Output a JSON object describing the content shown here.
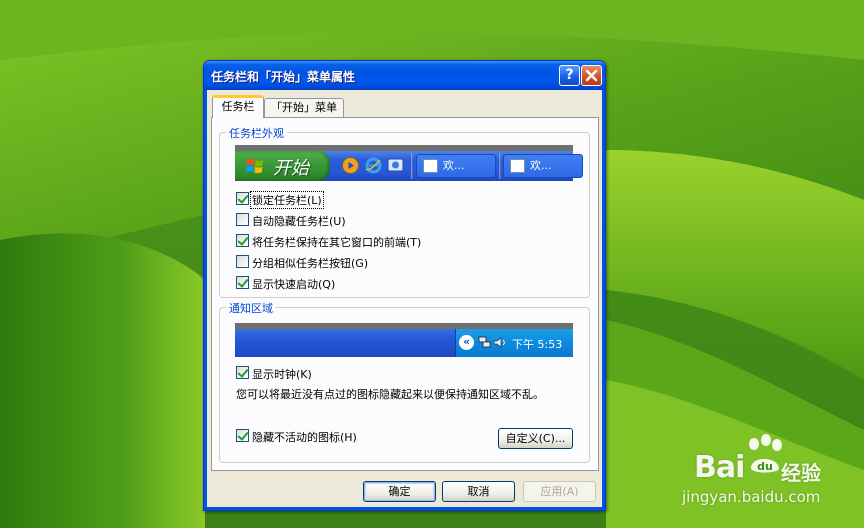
{
  "colors": {
    "title_bar": "#0054e3",
    "window_bg": "#ece9d8",
    "group_label": "#0046d5",
    "start_button": "#3c9b3a",
    "taskbar": "#2858d8",
    "tray": "#0d8ae0"
  },
  "watermark": {
    "brand": "Bai",
    "brand2": "经验",
    "url": "jingyan.baidu.com"
  },
  "window": {
    "title": "任务栏和「开始」菜单属性",
    "help_label": "?",
    "close_icon": "close-icon"
  },
  "tabs": [
    {
      "label": "任务栏",
      "active": true
    },
    {
      "label": "「开始」菜单",
      "active": false
    }
  ],
  "appearance": {
    "group_label": "任务栏外观",
    "start_label": "开始",
    "tasks": [
      "欢...",
      "欢..."
    ],
    "options": [
      {
        "label": "锁定任务栏(L)",
        "checked": true
      },
      {
        "label": "自动隐藏任务栏(U)",
        "checked": false
      },
      {
        "label": "将任务栏保持在其它窗口的前端(T)",
        "checked": true
      },
      {
        "label": "分组相似任务栏按钮(G)",
        "checked": false
      },
      {
        "label": "显示快速启动(Q)",
        "checked": true
      }
    ]
  },
  "notification": {
    "group_label": "通知区域",
    "chevron": "«",
    "clock": "下午 5:53",
    "show_clock": {
      "label": "显示时钟(K)",
      "checked": true
    },
    "info": "您可以将最近没有点过的图标隐藏起来以便保持通知区域不乱。",
    "hide_inactive": {
      "label": "隐藏不活动的图标(H)",
      "checked": true
    },
    "customize_label": "自定义(C)..."
  },
  "buttons": {
    "ok": "确定",
    "cancel": "取消",
    "apply": "应用(A)"
  }
}
